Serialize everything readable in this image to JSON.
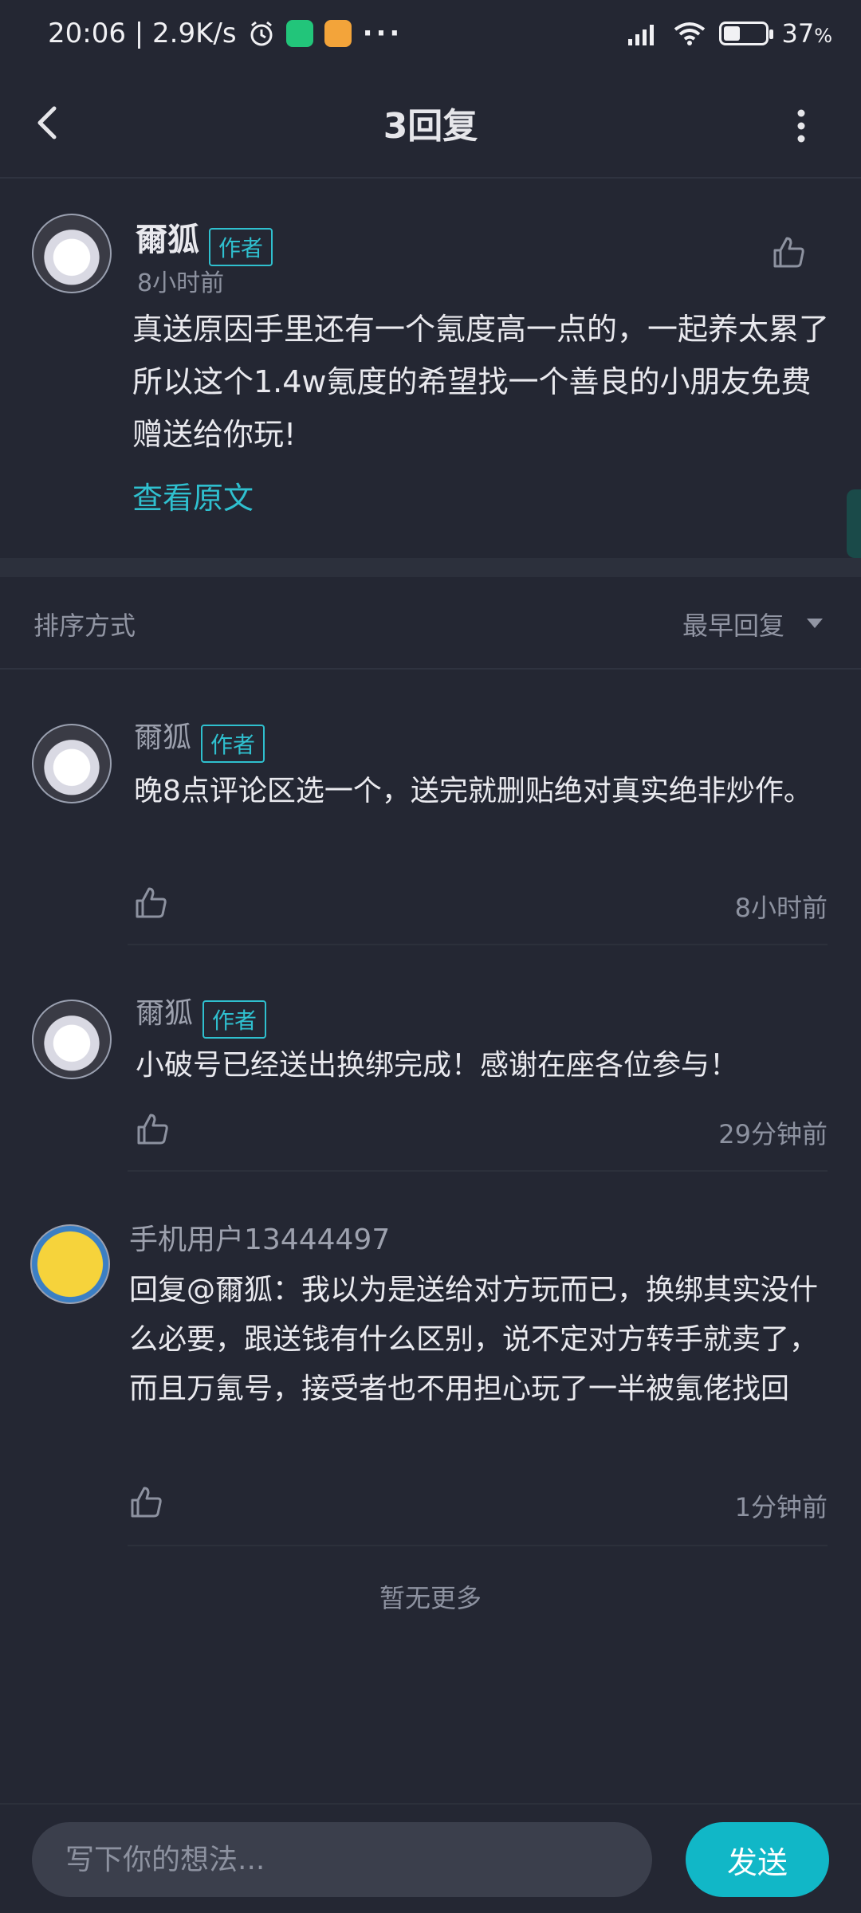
{
  "status_bar": {
    "time_speed": "20:06 | 2.9K/s",
    "battery_percent": "37",
    "battery_unit": "%",
    "icons": [
      "alarm-icon",
      "shield-app-icon",
      "chat-app-icon",
      "more-dots",
      "signal-icon",
      "wifi-icon",
      "battery-icon"
    ]
  },
  "header": {
    "title": "3回复",
    "icons": [
      "back-arrow-icon",
      "more-vertical-icon"
    ]
  },
  "main_post": {
    "author_name": "爾狐",
    "author_tag": "作者",
    "time": "8小时前",
    "content": "真送原因手里还有一个氪度高一点的，一起养太累了所以这个1.4w氪度的希望找一个善良的小朋友免费赠送给你玩!",
    "view_original": "查看原文"
  },
  "sort": {
    "label": "排序方式",
    "option": "最早回复"
  },
  "replies": [
    {
      "author_name": "爾狐",
      "author_tag": "作者",
      "content": "晚8点评论区选一个，送完就删贴绝对真实绝非炒作。",
      "time": "8小时前"
    },
    {
      "author_name": "爾狐",
      "author_tag": "作者",
      "content": "小破号已经送出换绑完成！感谢在座各位参与！",
      "time": "29分钟前"
    },
    {
      "author_name": "手机用户13444497",
      "author_tag": "",
      "content": "回复@爾狐：我以为是送给对方玩而已，换绑其实没什么必要，跟送钱有什么区别，说不定对方转手就卖了，而且万氪号，接受者也不用担心玩了一半被氪佬找回",
      "time": "1分钟前"
    }
  ],
  "footer": {
    "no_more": "暂无更多",
    "input_placeholder": "写下你的想法...",
    "send_label": "发送"
  },
  "colors": {
    "background": "#242733",
    "accent": "#2fc0cf",
    "send_button": "#11b7c7"
  }
}
